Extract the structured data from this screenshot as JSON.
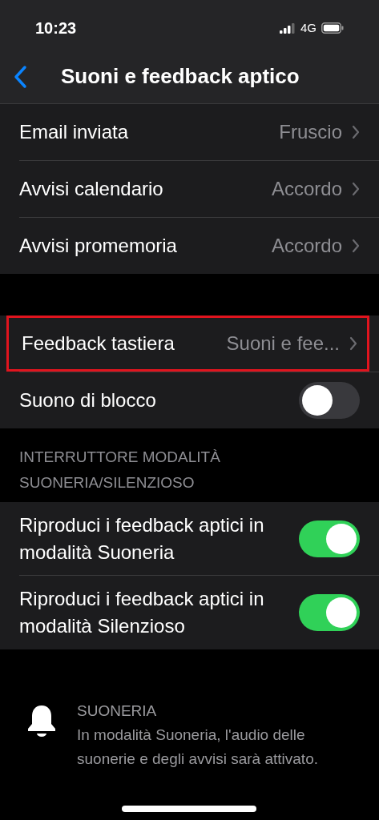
{
  "status_bar": {
    "time": "10:23",
    "network": "4G"
  },
  "nav": {
    "title": "Suoni e feedback aptico"
  },
  "groups": [
    {
      "items": [
        {
          "kind": "link",
          "label": "Email inviata",
          "value": "Fruscio",
          "highlighted": false
        },
        {
          "kind": "link",
          "label": "Avvisi calendario",
          "value": "Accordo",
          "highlighted": false
        },
        {
          "kind": "link",
          "label": "Avvisi promemoria",
          "value": "Accordo",
          "highlighted": false
        }
      ]
    },
    {
      "items": [
        {
          "kind": "link",
          "label": "Feedback tastiera",
          "value": "Suoni e fee...",
          "highlighted": true
        },
        {
          "kind": "toggle",
          "label": "Suono di blocco",
          "on": false
        }
      ]
    },
    {
      "header": "INTERRUTTORE MODALITÀ SUONERIA/SILENZIOSO",
      "items": [
        {
          "kind": "toggle",
          "label": "Riproduci i feedback aptici in modalità Suoneria",
          "on": true
        },
        {
          "kind": "toggle",
          "label": "Riproduci i feedback aptici in modalità Silenzioso",
          "on": true
        }
      ]
    }
  ],
  "info": {
    "title": "SUONERIA",
    "text": "In modalità Suoneria, l'audio delle suonerie e degli avvisi sarà attivato."
  }
}
